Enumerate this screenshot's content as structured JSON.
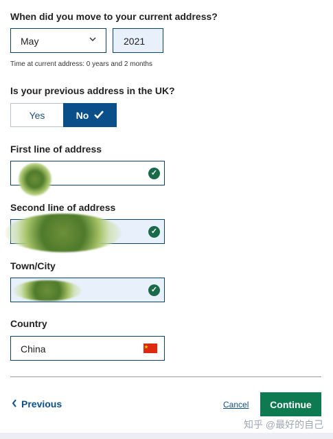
{
  "move_question": "When did you move to your current address?",
  "month_select": {
    "value": "May"
  },
  "year_input": {
    "value": "2021"
  },
  "time_at_address": "Time at current address: 0 years and 2 months",
  "uk_question": "Is your previous address in the UK?",
  "toggle": {
    "yes_label": "Yes",
    "no_label": "No",
    "selected": "No"
  },
  "fields": {
    "line1_label": "First line of address",
    "line2_label": "Second line of address",
    "town_label": "Town/City",
    "country_label": "Country",
    "country_value": "China"
  },
  "actions": {
    "previous": "Previous",
    "cancel": "Cancel",
    "continue": "Continue"
  },
  "watermark": "知乎 @最好的自己",
  "colors": {
    "primary_blue": "#0b4f8a",
    "success_green": "#1a6b4a",
    "continue_green": "#0e7a52",
    "field_tint": "#e8f1fb"
  }
}
